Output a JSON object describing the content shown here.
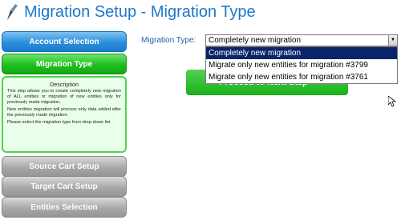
{
  "header": {
    "title": "Migration Setup - Migration Type",
    "logo_icon": "pen-logo-icon"
  },
  "sidebar": {
    "steps": [
      {
        "label": "Account Selection",
        "state": "done"
      },
      {
        "label": "Migration Type",
        "state": "active"
      },
      {
        "label": "Source Cart Setup",
        "state": "todo"
      },
      {
        "label": "Target Cart Setup",
        "state": "todo"
      },
      {
        "label": "Entities Selection",
        "state": "todo"
      }
    ],
    "description": {
      "title": "Description",
      "p1": "This step allows you to create completely new migration of ALL entities or migration of new entities only for previously made migration.",
      "p2": "New entities migration will process only data added after the previously made migration.",
      "p3": "Please select the migration type from drop-down list"
    }
  },
  "main": {
    "migration_type_label": "Migration Type:",
    "select": {
      "value": "Completely new migration",
      "arrow_icon": "chevron-down-icon",
      "options": [
        "Completely new migration",
        "Migrate only new entities for migration #3799",
        "Migrate only new entities for migration #3761"
      ],
      "selected_index": 0
    },
    "proceed_label": "Proceed to Next Step »"
  },
  "colors": {
    "title": "#1f78c8",
    "done": "#2a8fdc",
    "active": "#1fbf1f",
    "todo": "#a9a9a9",
    "selection": "#0a246a"
  }
}
